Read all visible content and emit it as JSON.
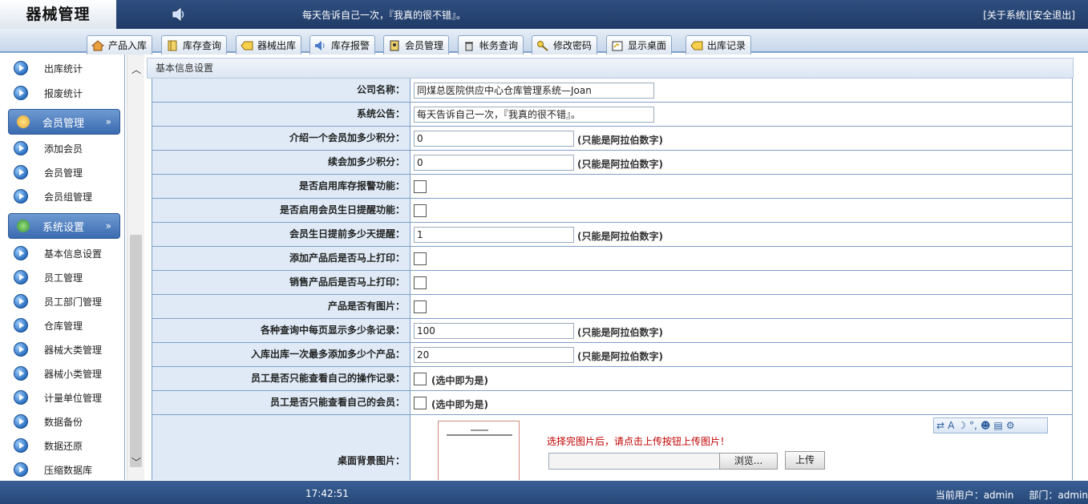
{
  "app": {
    "title": "器械管理",
    "notice": "每天告诉自己一次，『我真的很不错』。",
    "links": [
      "[关于系统]",
      "[安全退出]"
    ]
  },
  "tabs": [
    {
      "label": "产品入库",
      "icon": "house-icon"
    },
    {
      "label": "库存查询",
      "icon": "book-icon"
    },
    {
      "label": "器械出库",
      "icon": "tag-icon"
    },
    {
      "label": "库存报警",
      "icon": "speaker-icon"
    },
    {
      "label": "会员管理",
      "icon": "id-card-icon"
    },
    {
      "label": "帐务查询",
      "icon": "trash-icon"
    },
    {
      "label": "修改密码",
      "icon": "key-icon"
    },
    {
      "label": "显示桌面",
      "icon": "desktop-icon"
    },
    {
      "label": "出库记录",
      "icon": "tag-icon"
    }
  ],
  "sidebar": {
    "top_items": [
      "出库统计",
      "报废统计"
    ],
    "group_member": {
      "label": "会员管理",
      "items": [
        "添加会员",
        "会员管理",
        "会员组管理"
      ]
    },
    "group_system": {
      "label": "系统设置",
      "items": [
        "基本信息设置",
        "员工管理",
        "员工部门管理",
        "仓库管理",
        "器械大类管理",
        "器械小类管理",
        "计量单位管理",
        "数据备份",
        "数据还原",
        "压缩数据库"
      ]
    }
  },
  "form": {
    "section_title": "基本信息设置",
    "rows": [
      {
        "label": "公司名称：",
        "type": "text",
        "value": "同煤总医院供应中心仓库管理系统—Joan"
      },
      {
        "label": "系统公告：",
        "type": "text",
        "value": "每天告诉自己一次，『我真的很不错』。"
      },
      {
        "label": "介绍一个会员加多少积分：",
        "type": "number",
        "value": "0",
        "hint": "(只能是阿拉伯数字)"
      },
      {
        "label": "续会加多少积分：",
        "type": "number",
        "value": "0",
        "hint": "(只能是阿拉伯数字)"
      },
      {
        "label": "是否启用库存报警功能：",
        "type": "checkbox"
      },
      {
        "label": "是否启用会员生日提醒功能：",
        "type": "checkbox"
      },
      {
        "label": "会员生日提前多少天提醒：",
        "type": "number",
        "value": "1",
        "hint": "(只能是阿拉伯数字)"
      },
      {
        "label": "添加产品后是否马上打印：",
        "type": "checkbox"
      },
      {
        "label": "销售产品后是否马上打印：",
        "type": "checkbox"
      },
      {
        "label": "产品是否有图片：",
        "type": "checkbox"
      },
      {
        "label": "各种查询中每页显示多少条记录：",
        "type": "number",
        "value": "100",
        "hint": "(只能是阿拉伯数字)"
      },
      {
        "label": "入库出库一次最多添加多少个产品：",
        "type": "number",
        "value": "20",
        "hint": "(只能是阿拉伯数字)"
      },
      {
        "label": "员工是否只能查看自己的操作记录：",
        "type": "checkbox",
        "hint": "(选中即为是)"
      },
      {
        "label": "员工是否只能查看自己的会员：",
        "type": "checkbox",
        "hint": "(选中即为是)"
      }
    ],
    "bg_image": {
      "label": "桌面背景图片：",
      "tip": "选择完图片后，请点击上传按钮上传图片！",
      "browse_label": "浏览...",
      "upload_label": "上传"
    }
  },
  "status": {
    "clock": "17:42:51",
    "user": "当前用户：admin",
    "dept": "部门：admin"
  }
}
